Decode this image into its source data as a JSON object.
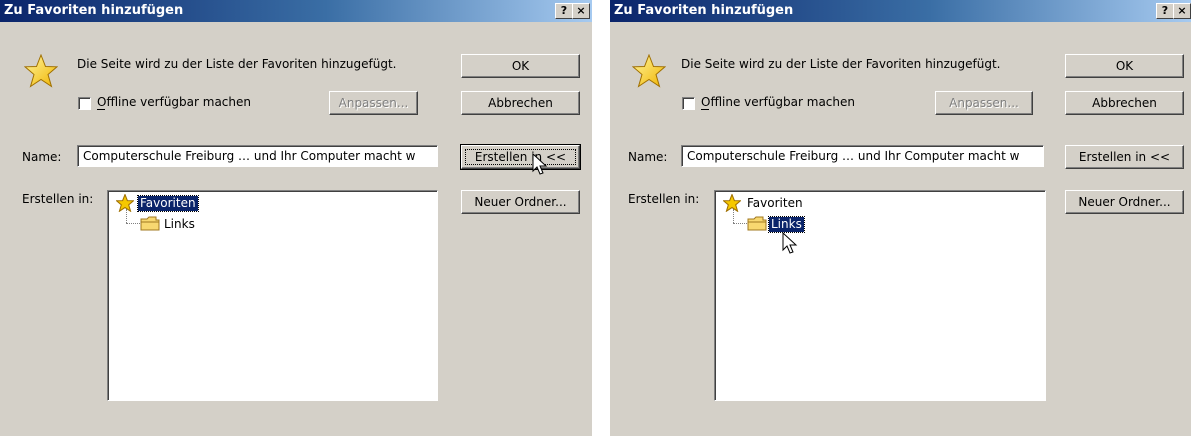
{
  "dialogs": [
    {
      "title": "Zu Favoriten hinzufügen",
      "help_label": "?",
      "close_label": "×",
      "description": "Die Seite wird zu der Liste der Favoriten hinzugefügt.",
      "offline_label": "Offline verfügbar machen",
      "customize_label": "Anpassen...",
      "ok_label": "OK",
      "cancel_label": "Abbrechen",
      "name_label": "Name:",
      "name_value": "Computerschule Freiburg … und Ihr Computer macht w",
      "create_in_button_label": "Erstellen in <<",
      "create_in_label": "Erstellen in:",
      "new_folder_label": "Neuer Ordner...",
      "tree": {
        "root": "Favoriten",
        "child": "Links",
        "selected": "Favoriten"
      }
    },
    {
      "title": "Zu Favoriten hinzufügen",
      "help_label": "?",
      "close_label": "×",
      "description": "Die Seite wird zu der Liste der Favoriten hinzugefügt.",
      "offline_label": "Offline verfügbar machen",
      "customize_label": "Anpassen...",
      "ok_label": "OK",
      "cancel_label": "Abbrechen",
      "name_label": "Name:",
      "name_value": "Computerschule Freiburg … und Ihr Computer macht w",
      "create_in_button_label": "Erstellen in <<",
      "create_in_label": "Erstellen in:",
      "new_folder_label": "Neuer Ordner...",
      "tree": {
        "root": "Favoriten",
        "child": "Links",
        "selected": "Links"
      }
    }
  ],
  "colors": {
    "title_bar_start": "#0a246a",
    "title_bar_end": "#a6caf0",
    "dialog_face": "#d4d0c8",
    "selection": "#0a246a"
  },
  "icons": {
    "dialog_icon": "star-icon",
    "tree_root_icon": "star-icon",
    "tree_child_icon": "folder-icon"
  }
}
